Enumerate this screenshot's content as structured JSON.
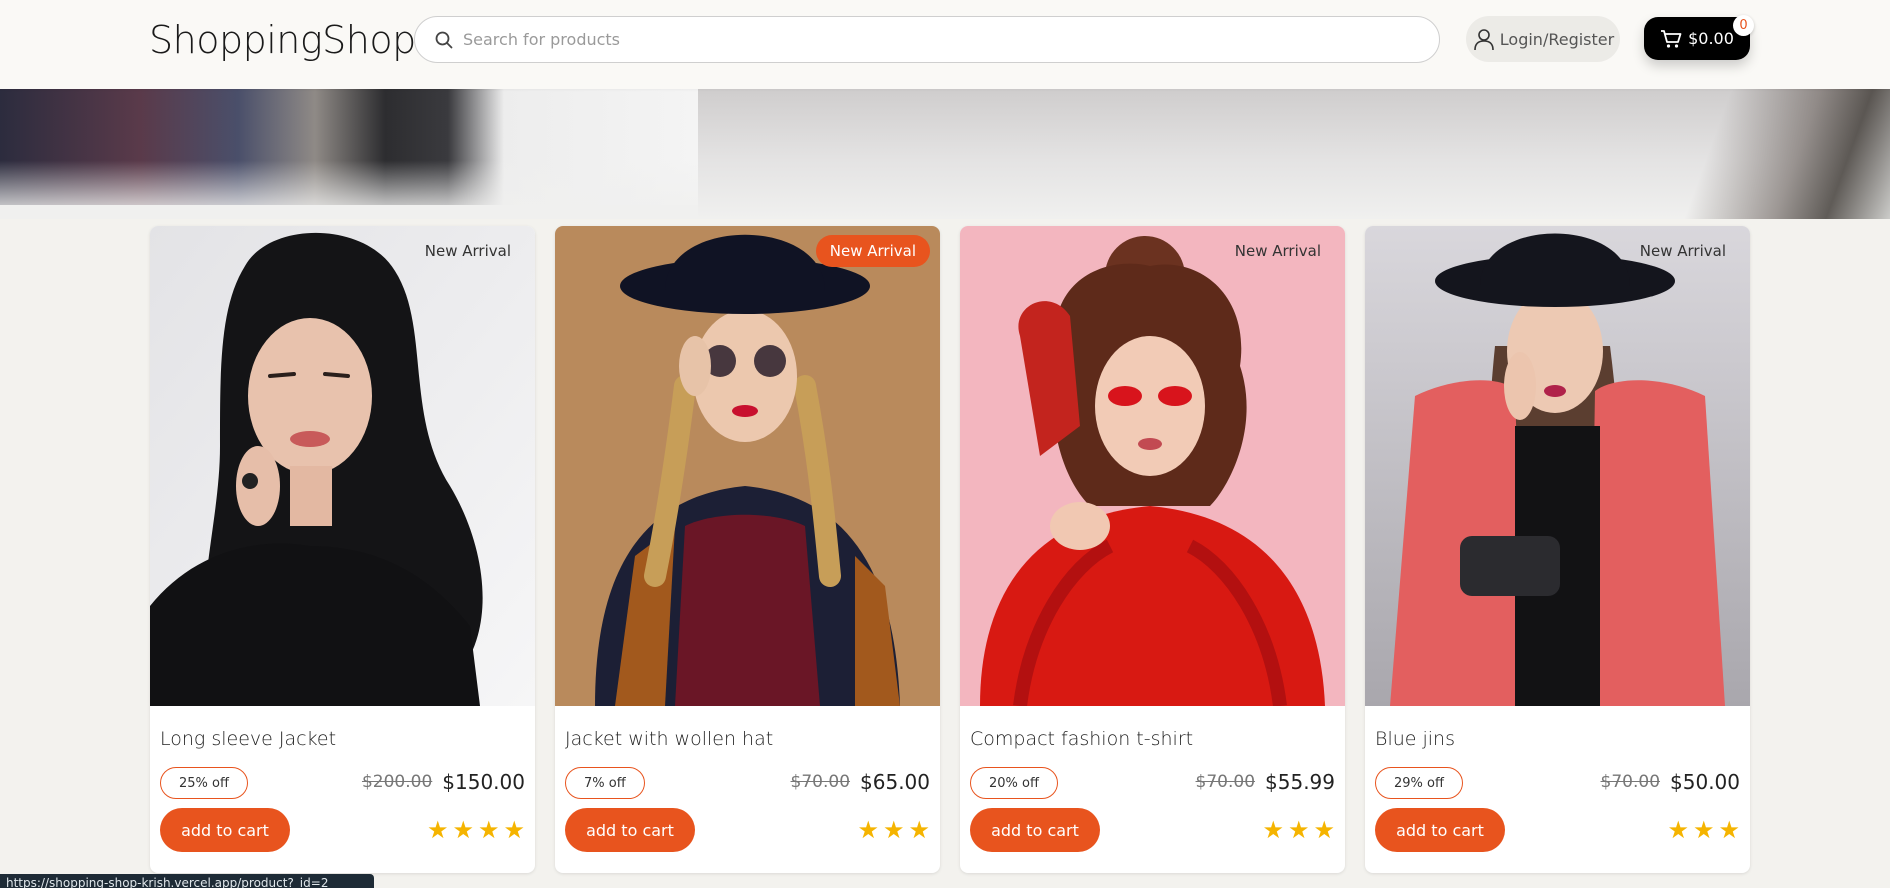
{
  "header": {
    "logo": "ShoppingShop",
    "search_placeholder": "Search for products",
    "login_label": "Login/Register",
    "cart_total": "$0.00",
    "cart_count": "0"
  },
  "colors": {
    "accent": "#e8541e",
    "star": "#f5b400",
    "cart_button": "#000000"
  },
  "products": [
    {
      "badge": "New Arrival",
      "badge_style": "plain",
      "name": "Long sleeve Jacket",
      "discount": "25% off",
      "old_price": "$200.00",
      "price": "$150.00",
      "button": "add to cart",
      "rating": 4
    },
    {
      "badge": "New Arrival",
      "badge_style": "highlighted",
      "name": "Jacket with wollen hat",
      "discount": "7% off",
      "old_price": "$70.00",
      "price": "$65.00",
      "button": "add to cart",
      "rating": 3
    },
    {
      "badge": "New Arrival",
      "badge_style": "plain",
      "name": "Compact fashion t-shirt",
      "discount": "20% off",
      "old_price": "$70.00",
      "price": "$55.99",
      "button": "add to cart",
      "rating": 3
    },
    {
      "badge": "New Arrival",
      "badge_style": "plain",
      "name": "Blue jins",
      "discount": "29% off",
      "old_price": "$70.00",
      "price": "$50.00",
      "button": "add to cart",
      "rating": 3
    }
  ],
  "status_bar": {
    "url": "https://shopping-shop-krish.vercel.app/product?_id=2"
  }
}
